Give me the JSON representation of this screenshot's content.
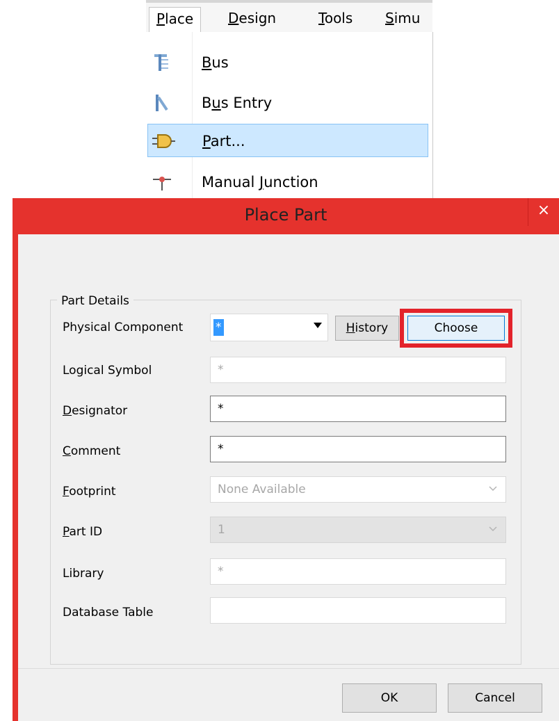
{
  "menubar": {
    "items": [
      {
        "id": "place",
        "text": "Place",
        "mn": "P",
        "rest": "lace"
      },
      {
        "id": "design",
        "text": "Design",
        "mn": "D",
        "rest": "esign"
      },
      {
        "id": "tools",
        "text": "Tools",
        "mn": "T",
        "rest": "ools"
      },
      {
        "id": "simu",
        "text": "Simu",
        "mn": "S",
        "rest": "imu"
      }
    ]
  },
  "menu": {
    "items": [
      {
        "pre": "",
        "mn": "B",
        "post": "us",
        "icon": "bus-icon"
      },
      {
        "pre": "B",
        "mn": "u",
        "post": "s Entry",
        "icon": "bus-entry-icon"
      },
      {
        "pre": "",
        "mn": "P",
        "post": "art...",
        "icon": "part-icon",
        "highlighted": true
      },
      {
        "pre": "Manual ",
        "mn": "J",
        "post": "unction",
        "icon": "junction-icon"
      }
    ]
  },
  "dialog": {
    "title": "Place Part",
    "close_glyph": "×",
    "group_title": "Part Details",
    "physical_component": {
      "label": "Physical Component",
      "value": "*"
    },
    "history_button": {
      "mn": "H",
      "rest": "istory"
    },
    "choose_button": "Choose",
    "fields": {
      "logical_symbol": {
        "label": "Logical Symbol",
        "value": "*"
      },
      "designator": {
        "mn": "D",
        "rest": "esignator",
        "value": "*"
      },
      "comment": {
        "mn": "C",
        "rest": "omment",
        "value": "*"
      },
      "footprint": {
        "mn": "F",
        "rest": "ootprint",
        "value": "None Available"
      },
      "part_id": {
        "mn": "P",
        "rest": "art ID",
        "value": "1"
      },
      "library": {
        "label": "Library",
        "value": "*"
      },
      "database_table": {
        "label": "Database Table",
        "value": ""
      }
    },
    "ok_button": "OK",
    "cancel_button": "Cancel"
  },
  "colors": {
    "title_bar": "#e5322d",
    "highlight_box": "#e3232b",
    "menu_highlight": "#cde8ff",
    "selection": "#3399ff"
  }
}
